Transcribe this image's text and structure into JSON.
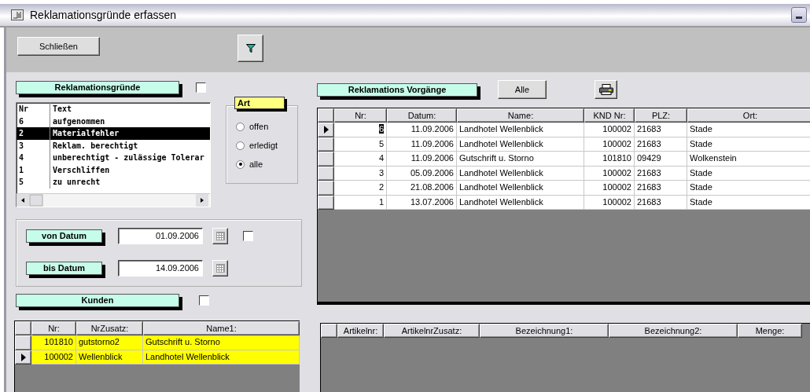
{
  "window": {
    "title": "Reklamationsgründe erfassen"
  },
  "toolbar": {
    "close_button": "Schließen"
  },
  "reasons": {
    "title": "Reklamationsgründe",
    "checked": false,
    "columns": [
      "Nr",
      "Text"
    ],
    "rows": [
      {
        "nr": "6",
        "text": "aufgenommen",
        "selected": false
      },
      {
        "nr": "2",
        "text": "Materialfehler",
        "selected": true
      },
      {
        "nr": "3",
        "text": "Reklam. berechtigt",
        "selected": false
      },
      {
        "nr": "4",
        "text": "unberechtigt - zulässige Tolerar",
        "selected": false
      },
      {
        "nr": "1",
        "text": "Verschliffen",
        "selected": false
      },
      {
        "nr": "5",
        "text": "zu unrecht",
        "selected": false
      }
    ]
  },
  "art": {
    "title": "Art",
    "options": [
      {
        "label": "offen",
        "selected": false
      },
      {
        "label": "erledigt",
        "selected": false
      },
      {
        "label": "alle",
        "selected": true
      }
    ]
  },
  "dates": [
    {
      "label": "von Datum",
      "value": "01.09.2006",
      "kind": "with_checkbox",
      "checked": false
    },
    {
      "label": "bis Datum",
      "value": "14.09.2006",
      "kind": "plain"
    }
  ],
  "customers": {
    "title": "Kunden",
    "checked": false,
    "columns": [
      "Nr:",
      "NrZusatz:",
      "Name1:"
    ],
    "rows": [
      {
        "cells": [
          "101810",
          "gutstorno2",
          "Gutschrift u. Storno"
        ],
        "selected": false
      },
      {
        "cells": [
          "100002",
          "Wellenblick",
          "Landhotel Wellenblick"
        ],
        "selected": true
      }
    ]
  },
  "cases": {
    "title": "Reklamations Vorgänge",
    "all_button": "Alle",
    "columns": [
      "Nr:",
      "Datum:",
      "Name:",
      "KND Nr:",
      "PLZ:",
      "Ort:"
    ],
    "rows": [
      {
        "cells": [
          "6",
          "11.09.2006",
          "Landhotel Wellenblick",
          "100002",
          "21683",
          "Stade"
        ],
        "selected": true
      },
      {
        "cells": [
          "5",
          "11.09.2006",
          "Landhotel Wellenblick",
          "100002",
          "21683",
          "Stade"
        ],
        "selected": false
      },
      {
        "cells": [
          "4",
          "11.09.2006",
          "Gutschrift u. Storno",
          "101810",
          "09429",
          "Wolkenstein"
        ],
        "selected": false
      },
      {
        "cells": [
          "3",
          "05.09.2006",
          "Landhotel Wellenblick",
          "100002",
          "21683",
          "Stade"
        ],
        "selected": false
      },
      {
        "cells": [
          "2",
          "21.08.2006",
          "Landhotel Wellenblick",
          "100002",
          "21683",
          "Stade"
        ],
        "selected": false
      },
      {
        "cells": [
          "1",
          "13.07.2006",
          "Landhotel Wellenblick",
          "100002",
          "21683",
          "Stade"
        ],
        "selected": false
      }
    ]
  },
  "articles": {
    "columns": [
      "Artikelnr:",
      "ArtikelnrZusatz:",
      "Bezeichnung1:",
      "Bezeichnung2:",
      "Menge:"
    ]
  }
}
